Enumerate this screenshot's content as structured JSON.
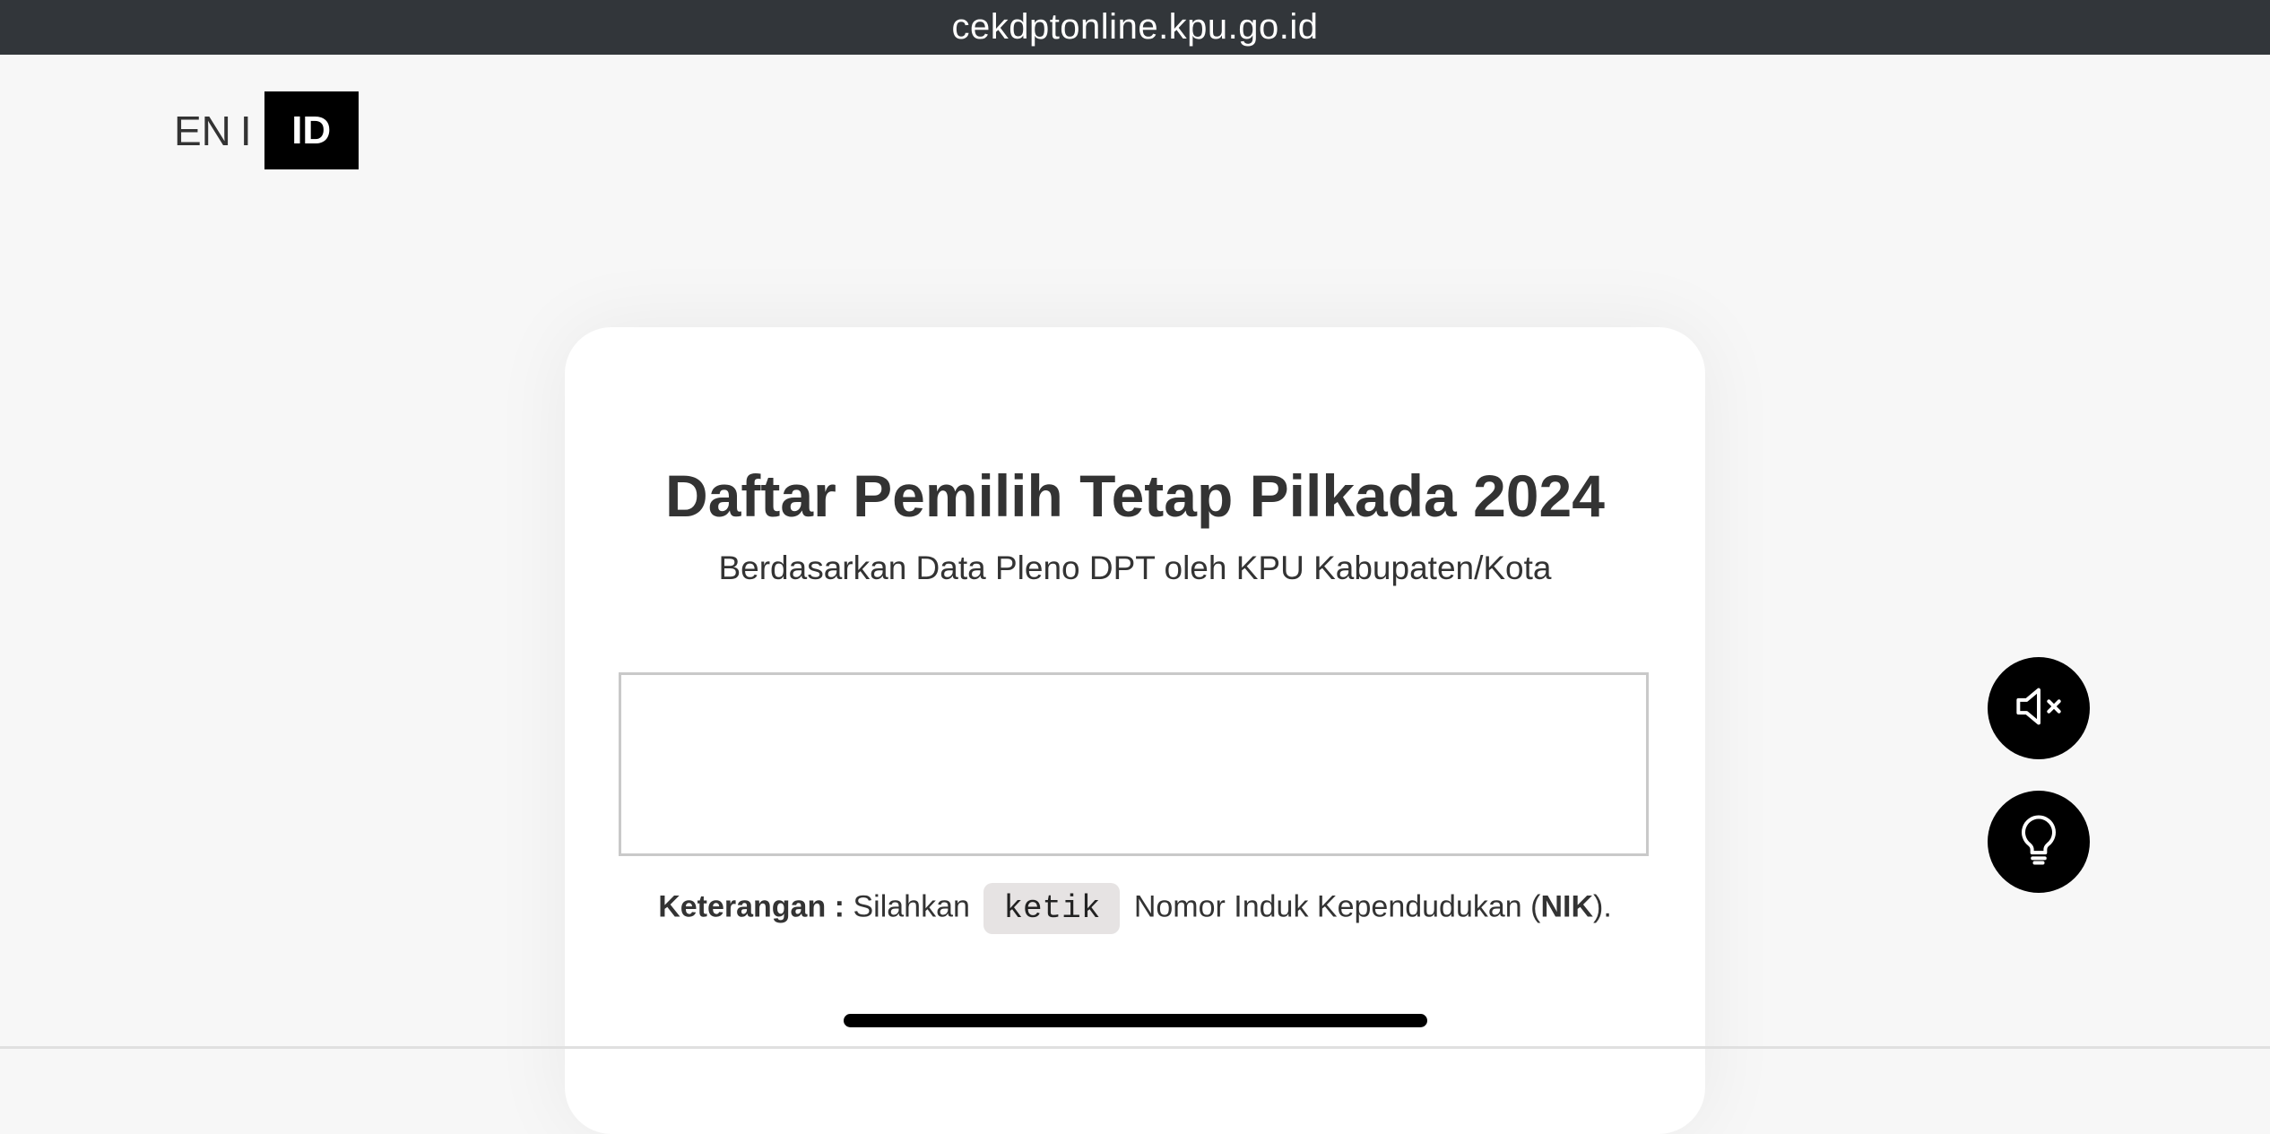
{
  "browser": {
    "url": "cekdptonline.kpu.go.id"
  },
  "language": {
    "en_label": "EN",
    "separator": "I",
    "id_label": "ID",
    "active": "ID"
  },
  "card": {
    "title": "Daftar Pemilih Tetap Pilkada 2024",
    "subtitle": "Berdasarkan Data Pleno DPT oleh KPU Kabupaten/Kota",
    "nik_input": {
      "value": "",
      "placeholder": ""
    },
    "note": {
      "label": "Keterangan :",
      "text_before": "Silahkan",
      "keyword": "ketik",
      "text_after": "Nomor Induk Kependudukan (",
      "bold_term": "NIK",
      "text_end": ")."
    }
  },
  "floating_buttons": {
    "mute_icon": "speaker-mute-icon",
    "hint_icon": "lightbulb-icon"
  },
  "colors": {
    "page_background": "#f7f7f7",
    "url_bar": "#32363a",
    "active_language": "#000000",
    "fab_background": "#000000",
    "keyword_chip": "#e6e3e3"
  }
}
